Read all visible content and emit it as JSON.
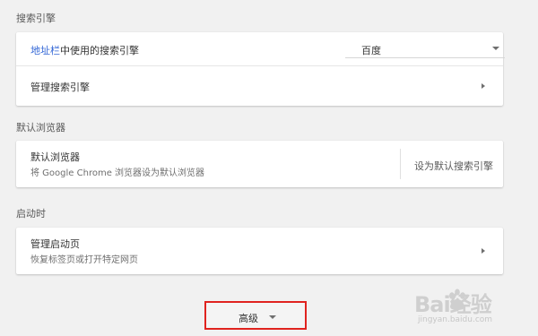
{
  "sections": {
    "search_engine": {
      "title": "搜索引擎",
      "address_bar_link": "地址栏",
      "address_bar_rest": "中使用的搜索引擎",
      "selected_engine": "百度",
      "manage_label": "管理搜索引擎"
    },
    "default_browser": {
      "title": "默认浏览器",
      "label": "默认浏览器",
      "description": "将 Google Chrome 浏览器设为默认浏览器",
      "action": "设为默认搜索引擎"
    },
    "startup": {
      "title": "启动时",
      "label": "管理启动页",
      "description": "恢复标签页或打开特定网页"
    }
  },
  "advanced": {
    "label": "高级"
  },
  "watermark": {
    "brand": "Bai经验",
    "url": "jingyan.baidu.com"
  },
  "colors": {
    "link": "#3367d6",
    "highlight_border": "#e0231f",
    "background": "#f1f1f1"
  },
  "icons": [
    "chevron-right-icon",
    "caret-down-icon",
    "baidu-paw-icon"
  ]
}
